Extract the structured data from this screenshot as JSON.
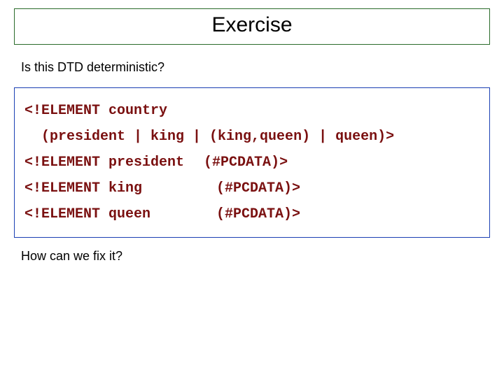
{
  "title": "Exercise",
  "question1": "Is this DTD deterministic?",
  "code": {
    "line1": "<!ELEMENT country",
    "line2": "  (president | king | (king,queen) | queen)>",
    "row1_left": "<!ELEMENT president",
    "row1_right": "(#PCDATA)>",
    "row2_left": "<!ELEMENT king",
    "row2_right": "(#PCDATA)>",
    "row3_left": "<!ELEMENT queen",
    "row3_right": "(#PCDATA)>"
  },
  "question2": "How can we fix it?"
}
